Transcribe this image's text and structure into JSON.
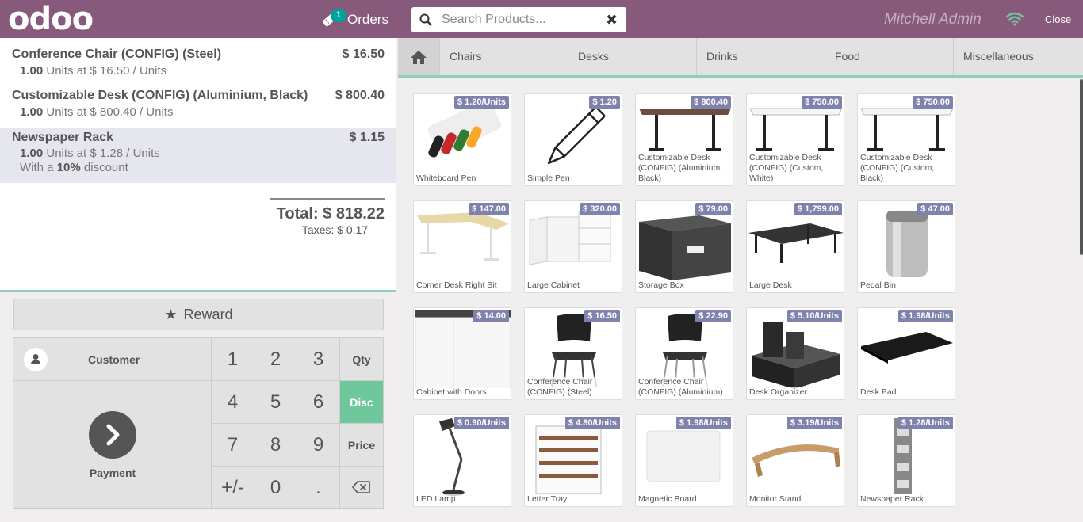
{
  "header": {
    "logo": "odoo",
    "orders_count": "1",
    "orders_label": "Orders",
    "search_placeholder": "Search Products...",
    "user": "Mitchell Admin",
    "close_label": "Close"
  },
  "order": {
    "lines": [
      {
        "name": "Conference Chair (CONFIG) (Steel)",
        "price": "$ 16.50",
        "qty": "1.00",
        "info": "Units at $ 16.50 / Units"
      },
      {
        "name": "Customizable Desk (CONFIG) (Aluminium, Black)",
        "price": "$ 800.40",
        "qty": "1.00",
        "info": "Units at $ 800.40 / Units"
      },
      {
        "name": "Newspaper Rack",
        "price": "$ 1.15",
        "qty": "1.00",
        "info": "Units at $ 1.28 / Units",
        "discount_prefix": "With a",
        "discount_value": "10%",
        "discount_suffix": "discount"
      }
    ],
    "total": "Total: $ 818.22",
    "taxes": "Taxes: $ 0.17"
  },
  "controls": {
    "reward": "Reward",
    "customer": "Customer",
    "payment": "Payment",
    "keys": [
      "1",
      "2",
      "3",
      "Qty",
      "4",
      "5",
      "6",
      "Disc",
      "7",
      "8",
      "9",
      "Price",
      "+/-",
      "0",
      "."
    ],
    "active_mode": "Disc"
  },
  "categories": [
    "Chairs",
    "Desks",
    "Drinks",
    "Food",
    "Miscellaneous"
  ],
  "products": [
    {
      "name": "Whiteboard Pen",
      "price": "$ 1.20/Units",
      "icon": "pen-set"
    },
    {
      "name": "Simple Pen",
      "price": "$ 1.20",
      "icon": "pen"
    },
    {
      "name": "Customizable Desk (CONFIG) (Aluminium, Black)",
      "price": "$ 800.40",
      "icon": "desk-brown"
    },
    {
      "name": "Customizable Desk (CONFIG) (Custom, White)",
      "price": "$ 750.00",
      "icon": "desk-white"
    },
    {
      "name": "Customizable Desk (CONFIG) (Custom, Black)",
      "price": "$ 750.00",
      "icon": "desk-white"
    },
    {
      "name": "Corner Desk Right Sit",
      "price": "$ 147.00",
      "icon": "corner-desk"
    },
    {
      "name": "Large Cabinet",
      "price": "$ 320.00",
      "icon": "cabinet"
    },
    {
      "name": "Storage Box",
      "price": "$ 79.00",
      "icon": "box"
    },
    {
      "name": "Large Desk",
      "price": "$ 1,799.00",
      "icon": "large-desk"
    },
    {
      "name": "Pedal Bin",
      "price": "$ 47.00",
      "icon": "bin"
    },
    {
      "name": "Cabinet with Doors",
      "price": "$ 14.00",
      "icon": "cabinet-doors"
    },
    {
      "name": "Conference Chair (CONFIG) (Steel)",
      "price": "$ 16.50",
      "icon": "chair"
    },
    {
      "name": "Conference Chair (CONFIG) (Aluminium)",
      "price": "$ 22.90",
      "icon": "chair"
    },
    {
      "name": "Desk Organizer",
      "price": "$ 5.10/Units",
      "icon": "organizer"
    },
    {
      "name": "Desk Pad",
      "price": "$ 1.98/Units",
      "icon": "desk-pad"
    },
    {
      "name": "LED Lamp",
      "price": "$ 0.90/Units",
      "icon": "lamp"
    },
    {
      "name": "Letter Tray",
      "price": "$ 4.80/Units",
      "icon": "tray"
    },
    {
      "name": "Magnetic Board",
      "price": "$ 1.98/Units",
      "icon": "board"
    },
    {
      "name": "Monitor Stand",
      "price": "$ 3.19/Units",
      "icon": "stand"
    },
    {
      "name": "Newspaper Rack",
      "price": "$ 1.28/Units",
      "icon": "rack"
    }
  ],
  "colors": {
    "brand": "#875a7b",
    "accent": "#6ec89b",
    "price_tag": "#7f82ac"
  }
}
